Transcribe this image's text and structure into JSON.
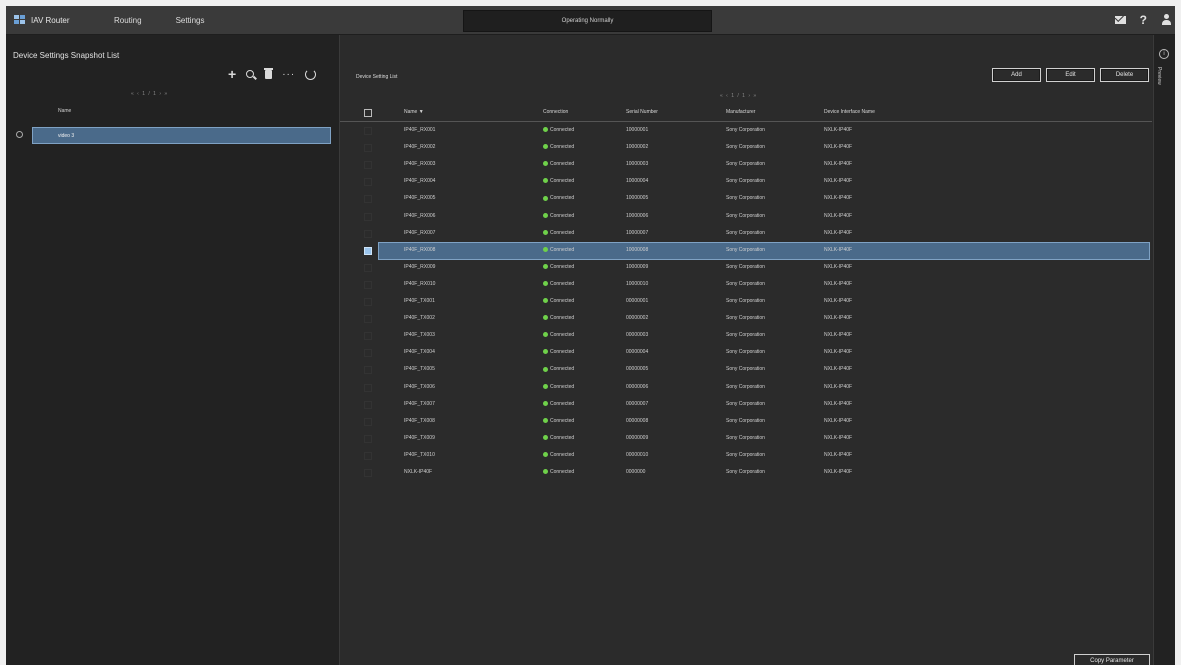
{
  "topbar": {
    "app_name": "IAV Router",
    "tabs": [
      "Routing",
      "Settings"
    ],
    "status": "Operating Normally"
  },
  "left": {
    "title": "Device Settings Snapshot List",
    "pager": "« ‹ 1 / 1 › »",
    "column": "Name",
    "rows": [
      "video 3"
    ]
  },
  "main": {
    "title": "Device Setting List",
    "pager": "« ‹ 1 / 1 › »",
    "buttons": {
      "add": "Add",
      "edit": "Edit",
      "delete": "Delete"
    },
    "columns": [
      "Name ▼",
      "Connection",
      "Serial Number",
      "Manufacturer",
      "Device Interface Name"
    ],
    "rows": [
      [
        "IP40F_RX001",
        "Connected",
        "10000001",
        "Sony Corporation",
        "NXLK-IP40F"
      ],
      [
        "IP40F_RX002",
        "Connected",
        "10000002",
        "Sony Corporation",
        "NXLK-IP40F"
      ],
      [
        "IP40F_RX003",
        "Connected",
        "10000003",
        "Sony Corporation",
        "NXLK-IP40F"
      ],
      [
        "IP40F_RX004",
        "Connected",
        "10000004",
        "Sony Corporation",
        "NXLK-IP40F"
      ],
      [
        "IP40F_RX005",
        "Connected",
        "10000005",
        "Sony Corporation",
        "NXLK-IP40F"
      ],
      [
        "IP40F_RX006",
        "Connected",
        "10000006",
        "Sony Corporation",
        "NXLK-IP40F"
      ],
      [
        "IP40F_RX007",
        "Connected",
        "10000007",
        "Sony Corporation",
        "NXLK-IP40F"
      ],
      [
        "IP40F_RX008",
        "Connected",
        "10000008",
        "Sony Corporation",
        "NXLK-IP40F"
      ],
      [
        "IP40F_RX009",
        "Connected",
        "10000009",
        "Sony Corporation",
        "NXLK-IP40F"
      ],
      [
        "IP40F_RX010",
        "Connected",
        "10000010",
        "Sony Corporation",
        "NXLK-IP40F"
      ],
      [
        "IP40F_TX001",
        "Connected",
        "00000001",
        "Sony Corporation",
        "NXLK-IP40F"
      ],
      [
        "IP40F_TX002",
        "Connected",
        "00000002",
        "Sony Corporation",
        "NXLK-IP40F"
      ],
      [
        "IP40F_TX003",
        "Connected",
        "00000003",
        "Sony Corporation",
        "NXLK-IP40F"
      ],
      [
        "IP40F_TX004",
        "Connected",
        "00000004",
        "Sony Corporation",
        "NXLK-IP40F"
      ],
      [
        "IP40F_TX005",
        "Connected",
        "00000005",
        "Sony Corporation",
        "NXLK-IP40F"
      ],
      [
        "IP40F_TX006",
        "Connected",
        "00000006",
        "Sony Corporation",
        "NXLK-IP40F"
      ],
      [
        "IP40F_TX007",
        "Connected",
        "00000007",
        "Sony Corporation",
        "NXLK-IP40F"
      ],
      [
        "IP40F_TX008",
        "Connected",
        "00000008",
        "Sony Corporation",
        "NXLK-IP40F"
      ],
      [
        "IP40F_TX009",
        "Connected",
        "00000009",
        "Sony Corporation",
        "NXLK-IP40F"
      ],
      [
        "IP40F_TX010",
        "Connected",
        "00000010",
        "Sony Corporation",
        "NXLK-IP40F"
      ],
      [
        "NXLK-IP40F",
        "Connected",
        "0000000",
        "Sony Corporation",
        "NXLK-IP40F"
      ]
    ],
    "selected_row": 7,
    "copy_button": "Copy Parameter"
  },
  "right_strip": {
    "label": "Preview"
  },
  "colors": {
    "accent": "#4a6a8a",
    "connected": "#6fd14a"
  },
  "icons": {
    "toolbar": [
      "plus-icon",
      "search-icon",
      "trash-icon",
      "more-icon",
      "refresh-icon"
    ]
  }
}
